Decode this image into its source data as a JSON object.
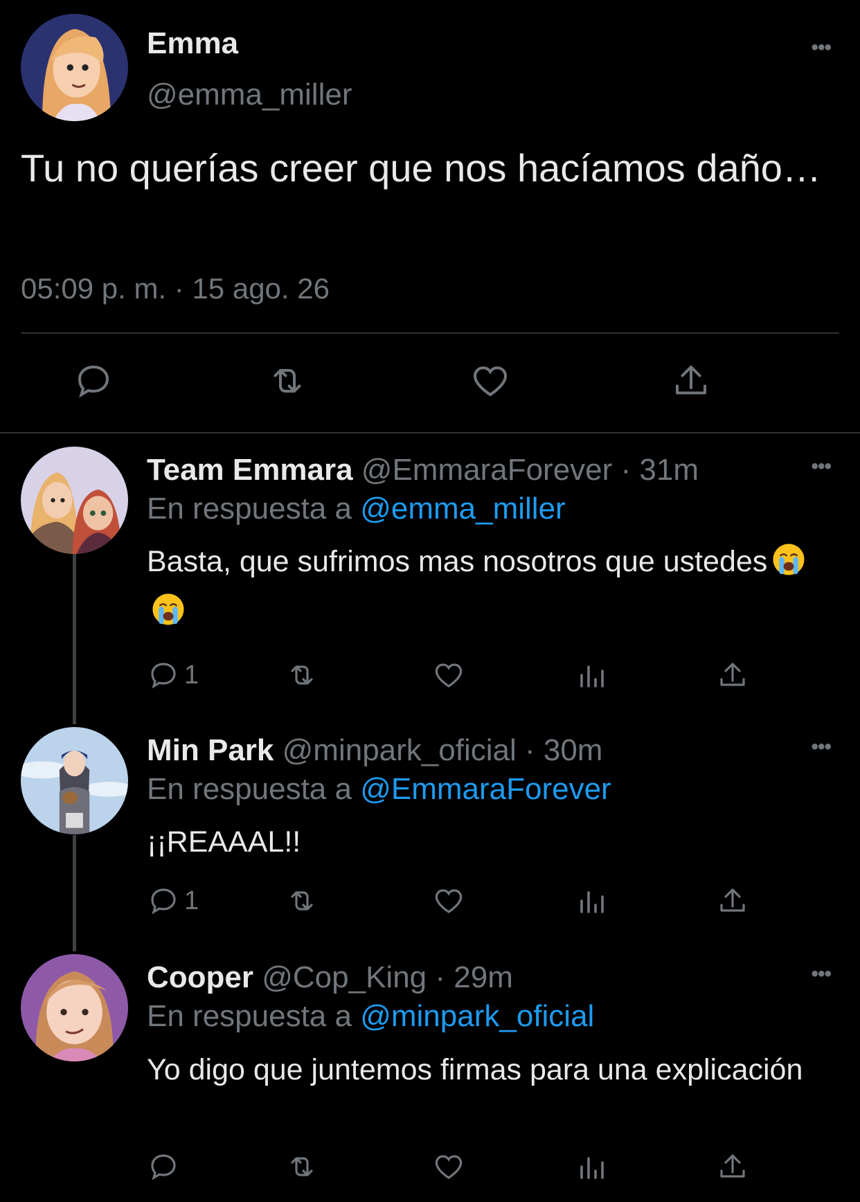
{
  "main_tweet": {
    "name": "Emma",
    "handle": "@emma_miller",
    "text": "Tu no querías creer que nos hacíamos daño…",
    "timestamp": "05:09 p. m. · 15 ago. 26",
    "more_icon": "more-horizontal-icon",
    "actions": [
      "reply-icon",
      "retweet-icon",
      "like-icon",
      "share-icon"
    ]
  },
  "replies": [
    {
      "name": "Team Emmara",
      "handle": "@EmmaraForever",
      "time": "· 31m",
      "replying_label": "En respuesta a",
      "replying_to": "@emma_miller",
      "text": "Basta, que sufrimos mas nosotros que ustedes",
      "emojis": [
        "loudly-crying-face",
        "loudly-crying-face"
      ],
      "reply_count": "1"
    },
    {
      "name": "Min Park",
      "handle": "@minpark_oficial",
      "time": "· 30m",
      "replying_label": "En respuesta a",
      "replying_to": "@EmmaraForever",
      "text": "¡¡REAAAL!!",
      "reply_count": "1"
    },
    {
      "name": "Cooper",
      "handle": "@Cop_King",
      "time": "· 29m",
      "replying_label": "En respuesta a",
      "replying_to": "@minpark_oficial",
      "text": "Yo digo que juntemos firmas para una explicación",
      "reply_count": ""
    }
  ],
  "colors": {
    "background": "#000000",
    "text": "#e7e9ea",
    "secondary": "#71767b",
    "link": "#1d9bf0",
    "divider": "#2f3336"
  }
}
